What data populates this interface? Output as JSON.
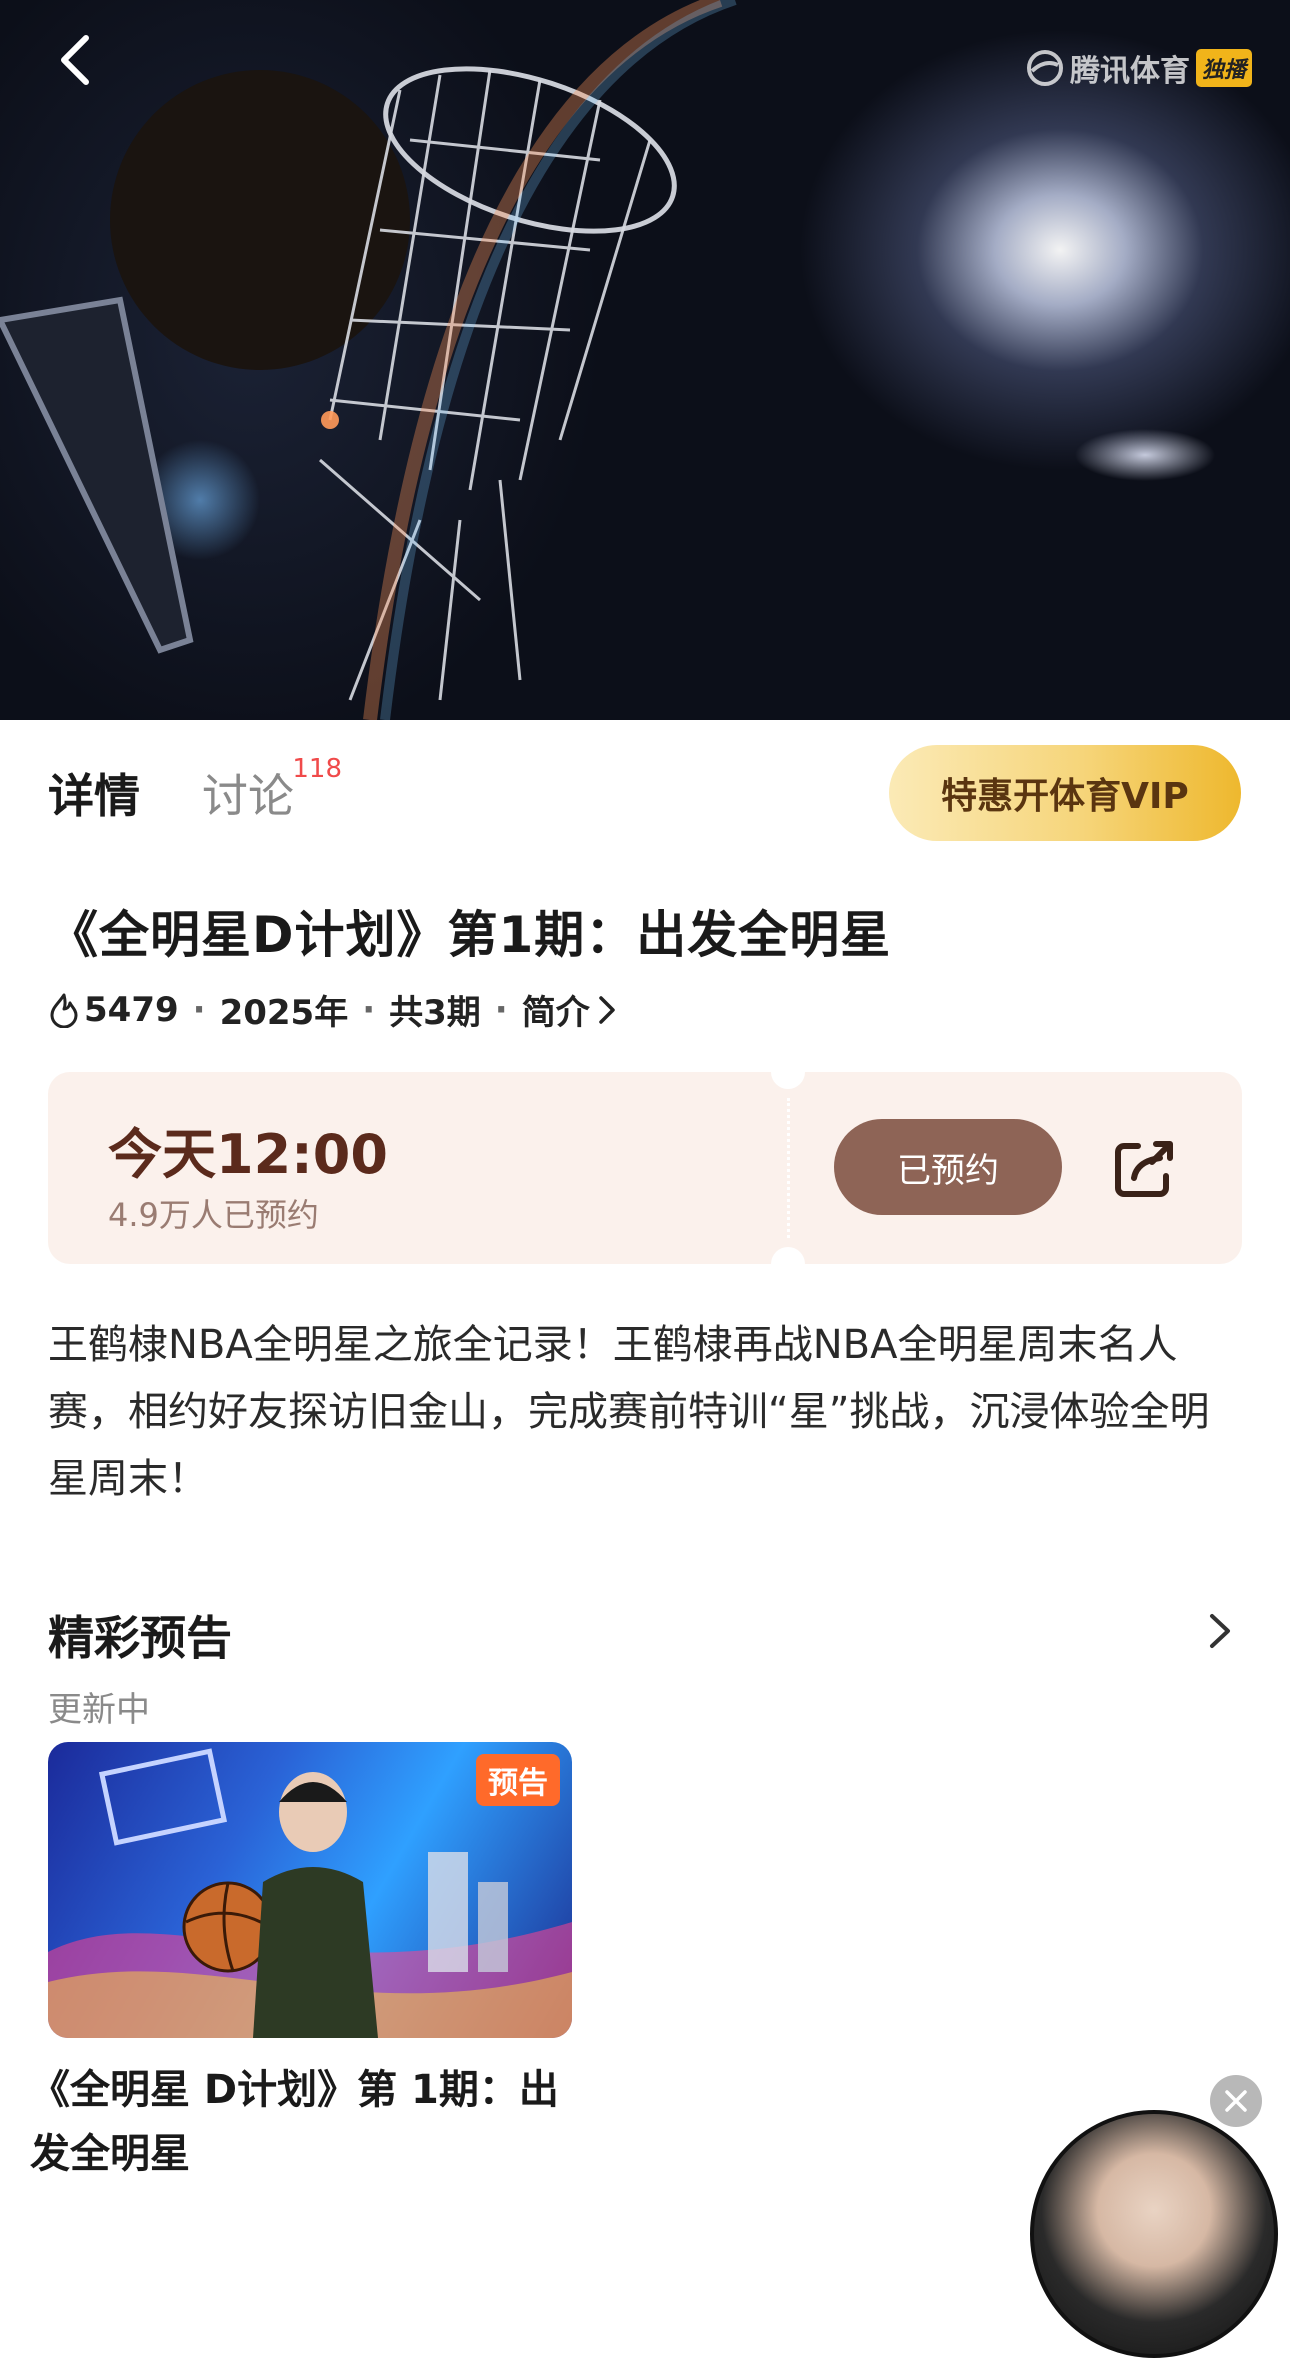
{
  "hero": {
    "brand_name": "腾讯体育",
    "brand_tag": "独播"
  },
  "tabs": [
    {
      "label": "详情"
    },
    {
      "label": "讨论",
      "badge": "118"
    }
  ],
  "vip_button": "特惠开体育VIP",
  "show": {
    "title": "《全明星D计划》第1期：出发全明星",
    "heat": "5479",
    "year": "2025年",
    "episodes": "共3期",
    "intro_label": "简介"
  },
  "booking": {
    "time": "今天12:00",
    "count": "4.9万人已预约",
    "button": "已预约"
  },
  "description": "王鹤棣NBA全明星之旅全记录！王鹤棣再战NBA全明星周末名人赛，相约好友探访旧金山，完成赛前特训“星”挑战，沉浸体验全明星周末！",
  "section": {
    "title": "精彩预告",
    "subtitle": "更新中"
  },
  "episode_card": {
    "badge": "预告",
    "title": "《全明星 D计划》第 1期：出发全明星"
  },
  "colors": {
    "accent_brown": "#8e6456",
    "booking_bg": "#fbf1ec",
    "vip_gold": "#f6d57a",
    "badge_red": "#f04a4a",
    "preview_orange": "#ff6a2a"
  },
  "icons": [
    "back-arrow-icon",
    "brand-logo-icon",
    "flame-icon",
    "chevron-right-icon",
    "share-icon",
    "close-icon"
  ]
}
